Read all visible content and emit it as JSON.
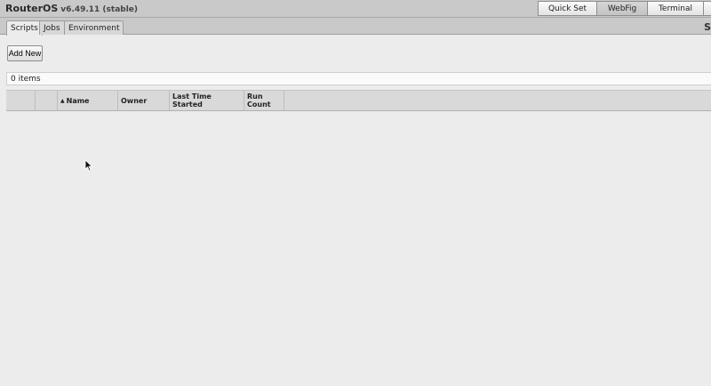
{
  "header": {
    "brand": "RouterOS",
    "version": "v6.49.11 (stable)",
    "mode_buttons": [
      {
        "label": "Quick Set",
        "active": false
      },
      {
        "label": "WebFig",
        "active": true
      },
      {
        "label": "Terminal",
        "active": false
      }
    ],
    "corner_letter": "S"
  },
  "tabs": [
    {
      "label": "Scripts",
      "active": true
    },
    {
      "label": "Jobs",
      "active": false
    },
    {
      "label": "Environment",
      "active": false
    }
  ],
  "toolbar": {
    "add_new_label": "Add New"
  },
  "list": {
    "count_text": "0 items",
    "sort_arrow": "▲",
    "columns": {
      "name": "Name",
      "owner": "Owner",
      "last_time_started": "Last Time Started",
      "run_count_line1": "Run",
      "run_count_line2": "Count"
    },
    "rows": []
  },
  "colors": {
    "topbar": "#c9c9c9",
    "content_bg": "#ececec",
    "header_row": "#d9d9d9"
  }
}
